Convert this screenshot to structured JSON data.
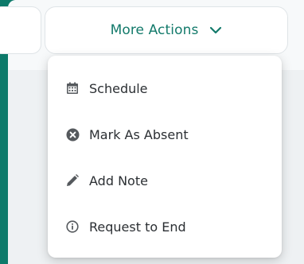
{
  "header": {
    "more_actions_label": "More Actions",
    "accent_color": "#137a6b"
  },
  "menu": {
    "items": [
      {
        "label": "Schedule",
        "icon": "calendar-icon"
      },
      {
        "label": "Mark As Absent",
        "icon": "close-circle-icon"
      },
      {
        "label": "Add Note",
        "icon": "pencil-icon"
      },
      {
        "label": "Request to End",
        "icon": "info-icon"
      }
    ]
  }
}
